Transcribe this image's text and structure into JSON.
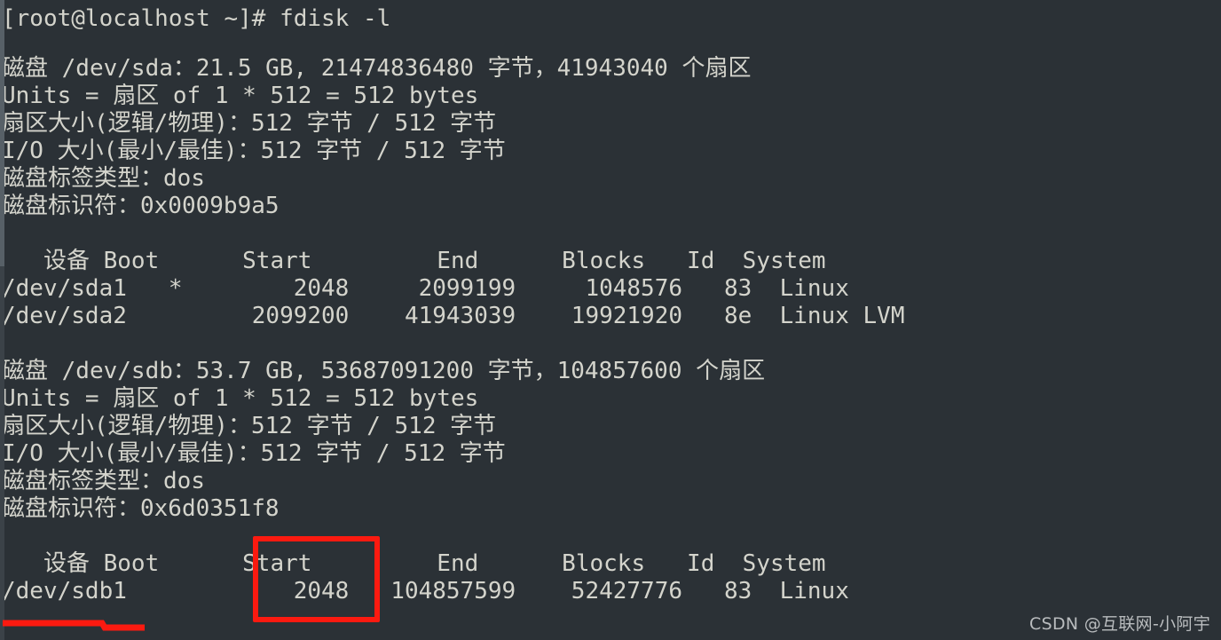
{
  "terminal": {
    "background_color": "#2b3136",
    "foreground_color": "#d4d4cc",
    "prompt_line": "[root@localhost ~]# fdisk -l",
    "clipped_top_line": "",
    "blocks": [
      {
        "name": "sda",
        "lines": [
          "磁盘 /dev/sda：21.5 GB, 21474836480 字节，41943040 个扇区",
          "Units = 扇区 of 1 * 512 = 512 bytes",
          "扇区大小(逻辑/物理)：512 字节 / 512 字节",
          "I/O 大小(最小/最佳)：512 字节 / 512 字节",
          "磁盘标签类型：dos",
          "磁盘标识符：0x0009b9a5"
        ],
        "table_header": "   设备 Boot      Start         End      Blocks   Id  System",
        "table_rows": [
          "/dev/sda1   *        2048     2099199     1048576   83  Linux",
          "/dev/sda2         2099200    41943039    19921920   8e  Linux LVM"
        ]
      },
      {
        "name": "sdb",
        "lines": [
          "磁盘 /dev/sdb：53.7 GB, 53687091200 字节，104857600 个扇区",
          "Units = 扇区 of 1 * 512 = 512 bytes",
          "扇区大小(逻辑/物理)：512 字节 / 512 字节",
          "I/O 大小(最小/最佳)：512 字节 / 512 字节",
          "磁盘标签类型：dos",
          "磁盘标识符：0x6d0351f8"
        ],
        "table_header": "   设备 Boot      Start         End      Blocks   Id  System",
        "table_rows": [
          "/dev/sdb1            2048   104857599    52427776   83  Linux"
        ]
      }
    ]
  },
  "annotations": {
    "highlight_box": {
      "color": "#fb1a10",
      "target_label": "Start",
      "target_value": "2048"
    },
    "underline": {
      "color": "#fb1a10",
      "target_label": "/dev/sdb1"
    }
  },
  "watermark": {
    "text": "CSDN @互联网-小阿宇"
  }
}
